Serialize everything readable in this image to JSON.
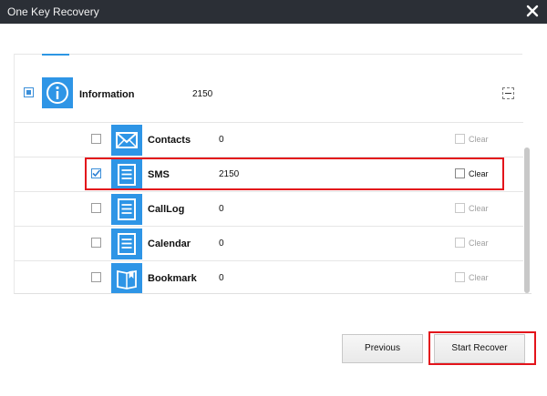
{
  "window": {
    "title": "One Key Recovery"
  },
  "group": {
    "name": "Information",
    "count": "2150",
    "checked": "partial"
  },
  "items": [
    {
      "name": "Contacts",
      "count": "0",
      "checked": false,
      "clear_label": "Clear",
      "clear_active": false,
      "icon": "envelope-icon"
    },
    {
      "name": "SMS",
      "count": "2150",
      "checked": true,
      "clear_label": "Clear",
      "clear_active": true,
      "icon": "document-icon"
    },
    {
      "name": "CallLog",
      "count": "0",
      "checked": false,
      "clear_label": "Clear",
      "clear_active": false,
      "icon": "document-icon"
    },
    {
      "name": "Calendar",
      "count": "0",
      "checked": false,
      "clear_label": "Clear",
      "clear_active": false,
      "icon": "document-icon"
    },
    {
      "name": "Bookmark",
      "count": "0",
      "checked": false,
      "clear_label": "Clear",
      "clear_active": false,
      "icon": "book-icon"
    }
  ],
  "buttons": {
    "previous": "Previous",
    "start_recover": "Start Recover"
  },
  "colors": {
    "titlebar": "#2b2f36",
    "accent": "#2e95e6",
    "highlight": "#e3141b"
  }
}
